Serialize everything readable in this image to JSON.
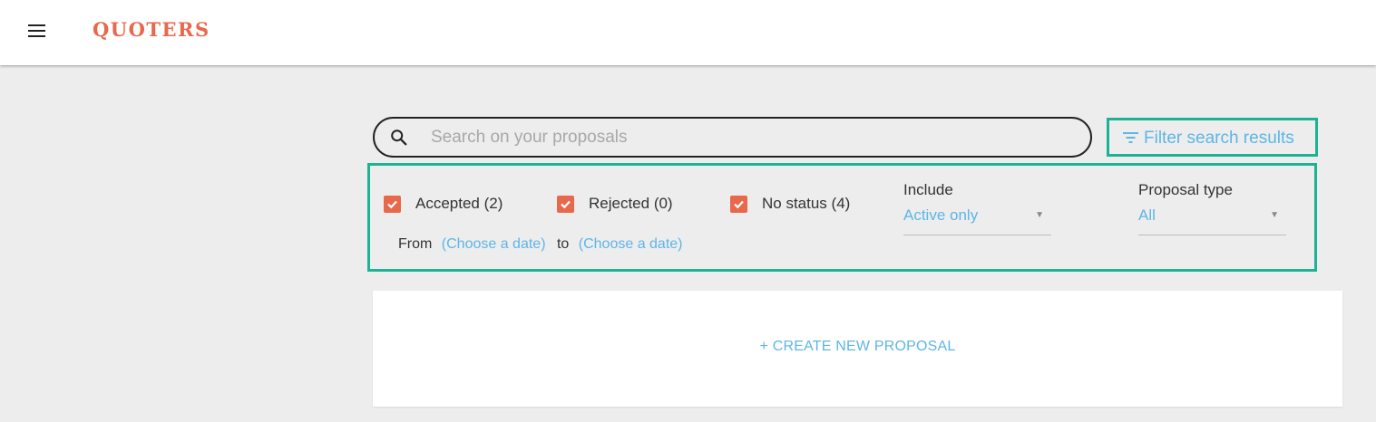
{
  "header": {
    "logo_text": "QUOTERS",
    "menu_icon": "hamburger-menu-icon",
    "logo_color": "#e8684c"
  },
  "search": {
    "placeholder": "Search on your proposals",
    "value": "",
    "icon": "search-icon"
  },
  "filter_button": {
    "label": "Filter search results",
    "icon": "filter-icon",
    "highlight_color": "#1bb394"
  },
  "filters": {
    "status_checkboxes": [
      {
        "label": "Accepted (2)",
        "checked": true
      },
      {
        "label": "Rejected (0)",
        "checked": true
      },
      {
        "label": "No status (4)",
        "checked": true
      }
    ],
    "include": {
      "label": "Include",
      "selected": "Active only"
    },
    "proposal_type": {
      "label": "Proposal type",
      "selected": "All"
    },
    "date_range": {
      "from_label": "From",
      "from_value": "(Choose a date)",
      "to_label": "to",
      "to_value": "(Choose a date)"
    }
  },
  "create": {
    "label": "+ CREATE NEW PROPOSAL"
  },
  "colors": {
    "accent": "#e8684c",
    "link": "#5db6e6",
    "highlight": "#1bb394",
    "background": "#ededed"
  }
}
